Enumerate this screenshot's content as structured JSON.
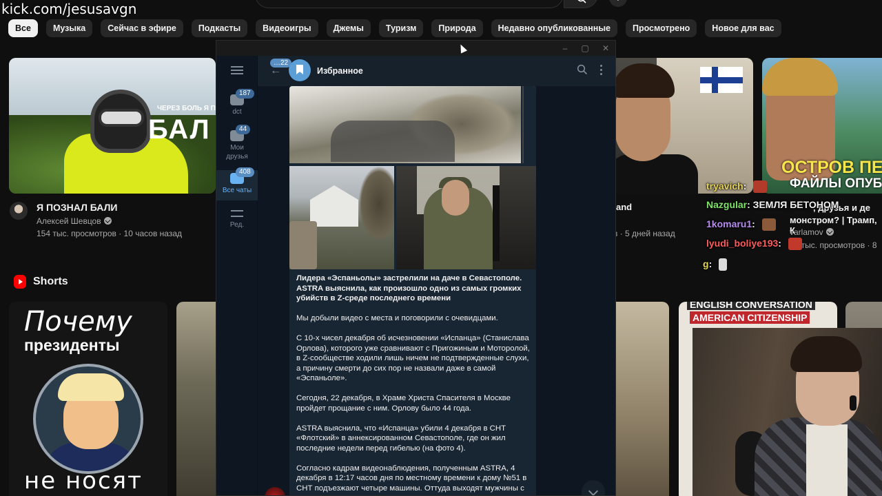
{
  "overlay": {
    "stream_url": "kick.com/jesusavgn"
  },
  "chips": [
    "Все",
    "Музыка",
    "Сейчас в эфире",
    "Подкасты",
    "Видеоигры",
    "Джемы",
    "Туризм",
    "Природа",
    "Недавно опубликованные",
    "Просмотрено",
    "Новое для вас"
  ],
  "video1": {
    "thumb_small": "ЧЕРЕЗ БОЛЬ Я П",
    "thumb_big": "БАЛ",
    "title": "Я ПОЗНАЛ БАЛИ",
    "channel": "Алексей Шевцов",
    "meta": "154 тыс. просмотров · 10 часов назад"
  },
  "video3": {
    "title_frag": "and",
    "meta_frag": "в · 5 дней назад"
  },
  "video4": {
    "thumb_line1": "ОСТРОВ ПЕ",
    "thumb_line2": "ФАЙЛЫ ОПУБ",
    "title_frag": ", друзья и де",
    "title_frag2": "монстром? | Трамп, К",
    "channel_frag": "varlamov",
    "meta_frag": "39 тыс. просмотров · 8"
  },
  "shorts": {
    "title": "Shorts",
    "short1": {
      "line1": "Почему",
      "line2": "президенты",
      "line3": "не носят"
    },
    "short4": {
      "line1": "ENGLISH CONVERSATION",
      "line2": "AMERICAN CITIZENSHIP"
    }
  },
  "chat": [
    {
      "user": "tryavich",
      "text": ":",
      "color": "#e5d35a"
    },
    {
      "user": "Nazgular",
      "text": ": ЗЕМЛЯ БЕТОНОМ",
      "color": "#7fe36a"
    },
    {
      "user": "1komaru1",
      "text": ":",
      "color": "#b78cf0"
    },
    {
      "user": "lyudi_boliye193",
      "text": ":",
      "color": "#ff5a5a"
    },
    {
      "user": "g",
      "text": ":",
      "color": "#e5d35a"
    }
  ],
  "telegram": {
    "chat_title": "Избранное",
    "back_badge": "22",
    "folders": [
      {
        "label": "dct",
        "badge": "187"
      },
      {
        "label": "Мои друзья",
        "badge": "44"
      },
      {
        "label": "Все чаты",
        "badge": "408"
      },
      {
        "label": "Ред.",
        "badge": ""
      }
    ],
    "message": {
      "headline": "Лидера «Эспаньолы» застрелили на даче в Севастополе. ASTRA выяснила, как произошло одно из самых громких убийств в Z-среде последнего времени",
      "p1": "Мы добыли видео с места и поговорили с очевидцами.",
      "p2": "С 10-х чисел декабря об исчезновении «Испанца» (Станислава Орлова), которого уже сравнивают с Пригожиным и Моторолой, в Z-сообществе ходили лишь ничем не подтвержденные слухи, а причину смерти до сих пор не назвали даже в самой «Эспаньоле».",
      "p3": "Сегодня, 22 декабря, в Храме Христа Спасителя в Москве пройдет прощание с ним. Орлову было 44 года.",
      "p4": "ASTRA выяснила, что «Испанца» убили 4 декабря в СНТ «Флотский» в аннексированном Севастополе, где он жил последние недели перед гибелью (на фото 4).",
      "p5": "Согласно кадрам видеонаблюдения, полученным ASTRA, 4 декабря в 12:17 часов дня по местному времени к дому №51 в СНТ подъезжают четыре машины. Оттуда выходят мужчины с"
    }
  }
}
